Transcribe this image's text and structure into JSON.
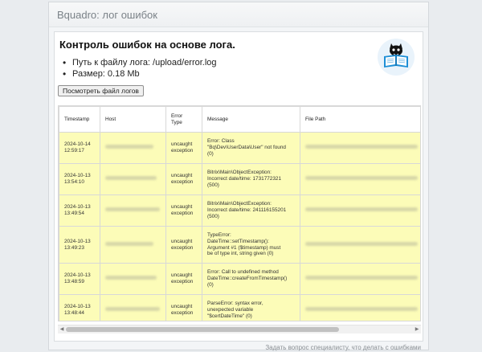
{
  "window": {
    "title": "Bquadro: лог ошибок"
  },
  "page": {
    "heading": "Контроль ошибок на основе лога.",
    "info": [
      "Путь к файлу лога: /upload/error.log",
      "Размер: 0.18 Mb"
    ],
    "view_button": "Посмотреть файл логов",
    "footer_link": "Задать вопрос специалисту, что делать с ошибками"
  },
  "table": {
    "headers": [
      "Timestamp",
      "Host",
      "Error\nType",
      "Message",
      "File Path"
    ],
    "rows": [
      {
        "timestamp": "2024-10-14\n12:59:17",
        "error_type": "uncaught\nexception",
        "message": "Error: Class\n\"Bq\\Dev\\UserData\\User\" not found\n(0)"
      },
      {
        "timestamp": "2024-10-13\n13:54:10",
        "error_type": "uncaught\nexception",
        "message": "Bitrix\\Main\\ObjectException:\nIncorrect date/time: 1731772321\n(500)"
      },
      {
        "timestamp": "2024-10-13\n13:49:54",
        "error_type": "uncaught\nexception",
        "message": "Bitrix\\Main\\ObjectException:\nIncorrect date/time: 241116155201\n(500)"
      },
      {
        "timestamp": "2024-10-13\n13:49:23",
        "error_type": "uncaught\nexception",
        "message": "TypeError:\nDateTime::setTimestamp():\nArgument #1 ($timestamp) must\nbe of type int, string given (0)"
      },
      {
        "timestamp": "2024-10-13\n13:48:59",
        "error_type": "uncaught\nexception",
        "message": "Error: Call to undefined method\nDateTime::createFromTimestamp()\n(0)"
      },
      {
        "timestamp": "2024-10-13\n13:48:44",
        "error_type": "uncaught\nexception",
        "message": "ParseError: syntax error,\nunexpected variable\n\"$certDateTime\" (0)"
      }
    ]
  },
  "icons": {
    "logo": "cat-reading-book-icon"
  },
  "colors": {
    "row_bg": "#fcfcb8",
    "logo_blue": "#1e8fd6"
  }
}
